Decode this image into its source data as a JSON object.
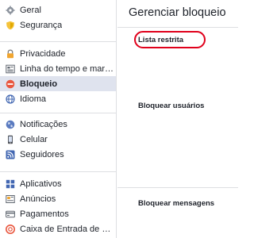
{
  "sidebar": {
    "groups": [
      {
        "items": [
          {
            "label": "Geral",
            "icon": "gear-icon"
          },
          {
            "label": "Segurança",
            "icon": "shield-icon"
          }
        ]
      },
      {
        "items": [
          {
            "label": "Privacidade",
            "icon": "lock-icon"
          },
          {
            "label": "Linha do tempo e marcação",
            "icon": "timeline-icon"
          },
          {
            "label": "Bloqueio",
            "icon": "block-icon",
            "active": true
          },
          {
            "label": "Idioma",
            "icon": "globe-icon"
          }
        ]
      },
      {
        "items": [
          {
            "label": "Notificações",
            "icon": "globe-notifications-icon"
          },
          {
            "label": "Celular",
            "icon": "mobile-icon"
          },
          {
            "label": "Seguidores",
            "icon": "rss-icon"
          }
        ]
      },
      {
        "items": [
          {
            "label": "Aplicativos",
            "icon": "apps-icon"
          },
          {
            "label": "Anúncios",
            "icon": "ads-icon"
          },
          {
            "label": "Pagamentos",
            "icon": "payments-icon"
          },
          {
            "label": "Caixa de Entrada de Suporte",
            "icon": "support-inbox-icon"
          }
        ]
      }
    ]
  },
  "main": {
    "title": "Gerenciar bloqueio",
    "sections": [
      {
        "title": "Lista restrita"
      },
      {
        "title": "Bloquear usuários"
      },
      {
        "title": "Bloquear mensagens"
      }
    ]
  },
  "colors": {
    "highlight": "#e0001b",
    "active_bg": "#dfe3ee",
    "divider": "#dddfe2",
    "block_icon": "#e9573f"
  }
}
